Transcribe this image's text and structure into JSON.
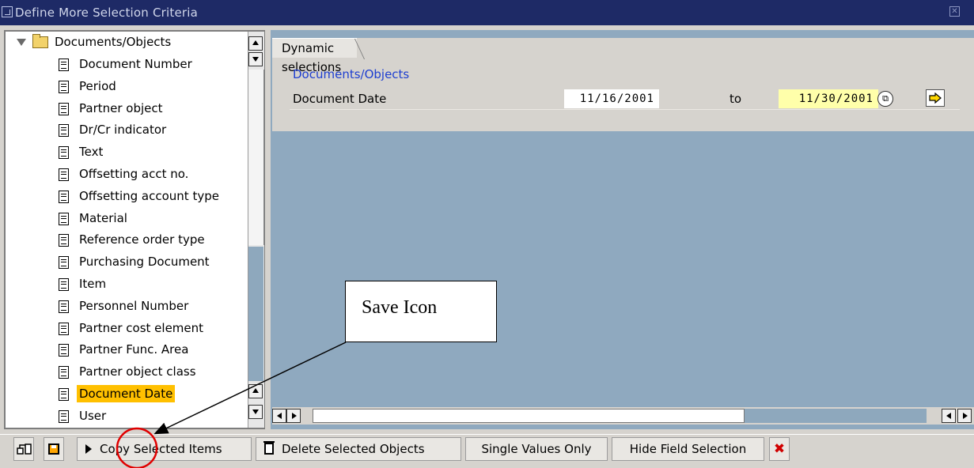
{
  "window": {
    "title": "Define More Selection Criteria"
  },
  "tree": {
    "root": "Documents/Objects",
    "items": [
      "Document Number",
      "Period",
      "Partner object",
      "Dr/Cr indicator",
      "Text",
      "Offsetting acct no.",
      "Offsetting account type",
      "Material",
      "Reference order type",
      "Purchasing Document",
      "Item",
      "Personnel Number",
      "Partner cost element",
      "Partner Func. Area",
      "Partner object class",
      "Document Date",
      "User"
    ],
    "selected": "Document Date"
  },
  "selection": {
    "tab": "Dynamic selections",
    "group": "Documents/Objects",
    "field_label": "Document Date",
    "from_value": "11/16/2001",
    "to_label": "to",
    "to_value": "11/30/2001"
  },
  "toolbar": {
    "copy": "Copy Selected Items",
    "delete": "Delete Selected Objects",
    "single": "Single Values Only",
    "hide": "Hide Field Selection"
  },
  "annotation": {
    "text": "Save Icon"
  },
  "colors": {
    "title_bar": "#1e2a66",
    "selection": "#ffc000",
    "group_title": "#1d3ed0",
    "workarea": "#8fa9bf",
    "callout_circle": "#e00000"
  },
  "icons": [
    "expand-triangle-icon",
    "folder-icon",
    "document-icon",
    "multiple-selection-icon",
    "arrow-right-icon",
    "hierarchy-icon",
    "save-icon",
    "play-icon",
    "trash-icon",
    "cancel-x-icon",
    "close-icon"
  ]
}
